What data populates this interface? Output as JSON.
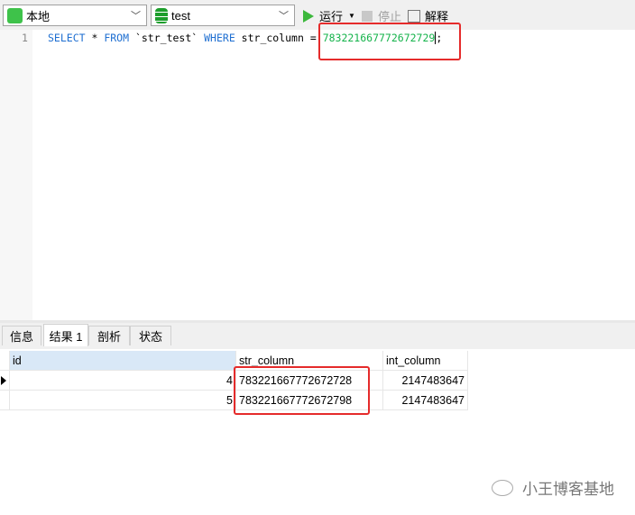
{
  "toolbar": {
    "connection": "本地",
    "database": "test",
    "run_label": "运行",
    "stop_label": "停止",
    "explain_label": "解释"
  },
  "editor": {
    "line_number": "1",
    "sql": {
      "p1": "SELECT",
      "p2": " * ",
      "p3": "FROM",
      "p4": " `str_test` ",
      "p5": "WHERE",
      "p6": " str_column = ",
      "p7": "783221667772672729",
      "p8": ";"
    }
  },
  "tabs": [
    "信息",
    "结果 1",
    "剖析",
    "状态"
  ],
  "grid": {
    "columns": [
      "id",
      "str_column",
      "int_column"
    ],
    "rows": [
      [
        "4",
        "783221667772672728",
        "2147483647"
      ],
      [
        "5",
        "783221667772672798",
        "2147483647"
      ]
    ]
  },
  "watermark": "小王博客基地",
  "colors": {
    "accent_red": "#e52b2b",
    "keyword": "#1f6fd1",
    "number": "#15b34b"
  }
}
